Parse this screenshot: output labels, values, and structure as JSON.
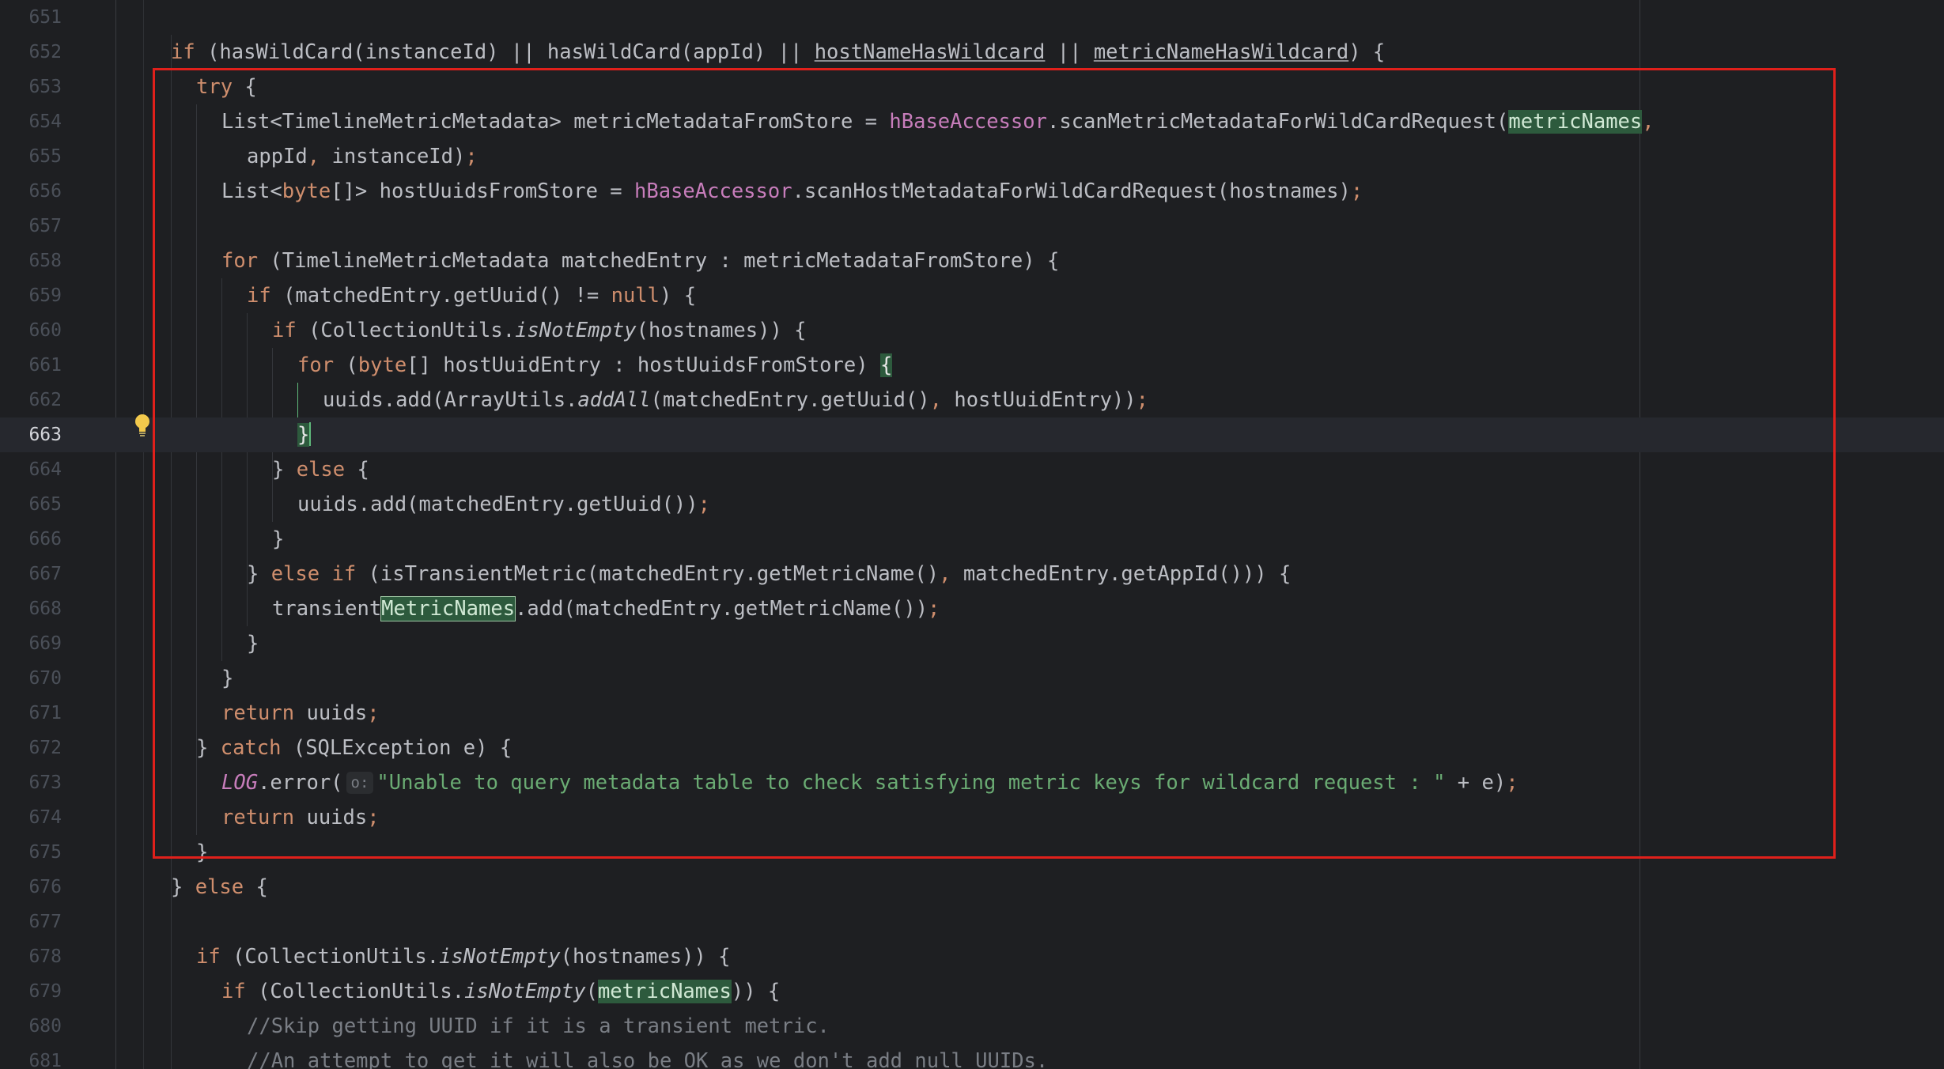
{
  "editor": {
    "current_line": "663",
    "lines": [
      {
        "n": "651"
      },
      {
        "n": "652"
      },
      {
        "n": "653"
      },
      {
        "n": "654"
      },
      {
        "n": "655"
      },
      {
        "n": "656"
      },
      {
        "n": "657"
      },
      {
        "n": "658"
      },
      {
        "n": "659"
      },
      {
        "n": "660"
      },
      {
        "n": "661"
      },
      {
        "n": "662"
      },
      {
        "n": "663"
      },
      {
        "n": "664"
      },
      {
        "n": "665"
      },
      {
        "n": "666"
      },
      {
        "n": "667"
      },
      {
        "n": "668"
      },
      {
        "n": "669"
      },
      {
        "n": "670"
      },
      {
        "n": "671"
      },
      {
        "n": "672"
      },
      {
        "n": "673"
      },
      {
        "n": "674"
      },
      {
        "n": "675"
      },
      {
        "n": "676"
      },
      {
        "n": "677"
      },
      {
        "n": "678"
      },
      {
        "n": "679"
      },
      {
        "n": "680"
      },
      {
        "n": "681"
      }
    ],
    "code": {
      "l652": {
        "kw_if": "if",
        "a": " (hasWildCard(instanceId) || hasWildCard(appId) || ",
        "u1": "hostNameHasWildcard",
        "b": " || ",
        "u2": "metricNameHasWildcard",
        "c": ") {"
      },
      "l653": {
        "kw": "try",
        "rest": " {"
      },
      "l654": {
        "a": "List<TimelineMetricMetadata> metricMetadataFromStore = ",
        "fld": "hBaseAccessor",
        "b": ".scanMetricMetadataForWildCardRequest(",
        "hl": "metricNames",
        "c": ","
      },
      "l655": {
        "a": "appId",
        "p1": ",",
        "b": " instanceId)",
        "p2": ";"
      },
      "l656": {
        "a": "List<",
        "kw": "byte",
        "b": "[]> hostUuidsFromStore = ",
        "fld": "hBaseAccessor",
        "c": ".scanHostMetadataForWildCardRequest(hostnames)",
        "p": ";"
      },
      "l658": {
        "kw": "for",
        "rest": " (TimelineMetricMetadata matchedEntry : metricMetadataFromStore) {"
      },
      "l659": {
        "kw": "if",
        "a": " (matchedEntry.getUuid() != ",
        "kw2": "null",
        "b": ") {"
      },
      "l660": {
        "kw": "if",
        "a": " (CollectionUtils.",
        "it": "isNotEmpty",
        "b": "(hostnames)) {"
      },
      "l661": {
        "kw": "for",
        "a": " (",
        "kw2": "byte",
        "b": "[] hostUuidEntry : hostUuidsFromStore) ",
        "brace": "{"
      },
      "l662": {
        "a": "uuids.add(ArrayUtils.",
        "it": "addAll",
        "b": "(matchedEntry.getUuid()",
        "p1": ",",
        "c": " hostUuidEntry))",
        "p2": ";"
      },
      "l663": {
        "brace": "}"
      },
      "l664": {
        "a": "} ",
        "kw": "else",
        "b": " {"
      },
      "l665": {
        "a": "uuids.add(matchedEntry.getUuid())",
        "p": ";"
      },
      "l666": {
        "a": "}"
      },
      "l667": {
        "a": "} ",
        "kw": "else if",
        "b": " (isTransientMetric(matchedEntry.getMetricName()",
        "p": ",",
        "c": " matchedEntry.getAppId())) {"
      },
      "l668": {
        "a": "transient",
        "hl": "MetricNames",
        "b": ".add(matchedEntry.getMetricName())",
        "p": ";"
      },
      "l669": {
        "a": "}"
      },
      "l670": {
        "a": "}"
      },
      "l671": {
        "kw": "return",
        "a": " uuids",
        "p": ";"
      },
      "l672": {
        "a": "} ",
        "kw": "catch",
        "b": " (SQLException e) {"
      },
      "l673": {
        "log": "LOG",
        "a": ".error(",
        "hint": "o:",
        "str": "\"Unable to query metadata table to check satisfying metric keys for wildcard request : \"",
        "b": " + e)",
        "p": ";"
      },
      "l674": {
        "kw": "return",
        "a": " uuids",
        "p": ";"
      },
      "l675": {
        "a": "}"
      },
      "l676": {
        "a": "} ",
        "kw": "else",
        "b": " {"
      },
      "l678": {
        "kw": "if",
        "a": " (CollectionUtils.",
        "it": "isNotEmpty",
        "b": "(hostnames)) {"
      },
      "l679": {
        "kw": "if",
        "a": " (CollectionUtils.",
        "it": "isNotEmpty",
        "b": "(",
        "hl": "metricNames",
        "c": ")) {"
      },
      "l680": {
        "cmt": "//Skip getting UUID if it is a transient metric."
      },
      "l681": {
        "cmt": "//An attempt to get it will also be OK as we don't add null UUIDs."
      }
    }
  },
  "colors": {
    "background": "#1e1f22",
    "keyword": "#cf8e6d",
    "field": "#c77dbb",
    "string": "#6aab73",
    "comment": "#7a7e85",
    "highlight": "#2d5a3d",
    "annotation_box": "#e0201b"
  },
  "icons": {
    "intention": "lightbulb-icon"
  }
}
